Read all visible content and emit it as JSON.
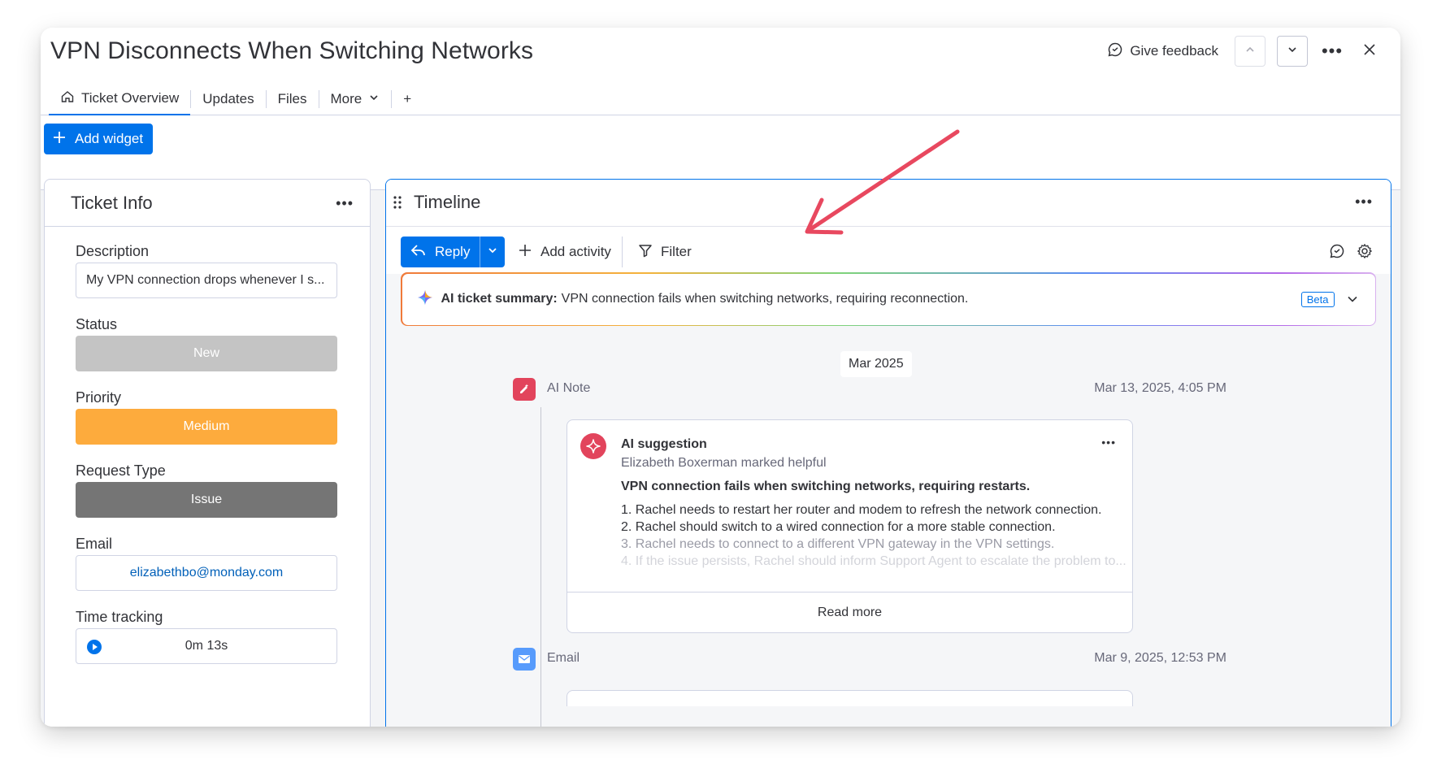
{
  "header": {
    "title": "VPN Disconnects When Switching Networks",
    "give_feedback": "Give feedback"
  },
  "tabs": [
    {
      "label": "Ticket Overview"
    },
    {
      "label": "Updates"
    },
    {
      "label": "Files"
    },
    {
      "label": "More"
    },
    {
      "label": "+"
    }
  ],
  "toolbar": {
    "add_widget": "Add widget"
  },
  "ticket_info": {
    "title": "Ticket Info",
    "description_label": "Description",
    "description_value": "My VPN connection drops whenever I s...",
    "status_label": "Status",
    "status_value": "New",
    "priority_label": "Priority",
    "priority_value": "Medium",
    "request_type_label": "Request Type",
    "request_type_value": "Issue",
    "email_label": "Email",
    "email_value": "elizabethbo@monday.com",
    "time_tracking_label": "Time tracking",
    "time_tracking_value": "0m 13s"
  },
  "timeline": {
    "title": "Timeline",
    "reply": "Reply",
    "add_activity": "Add activity",
    "filter": "Filter",
    "ai_summary_label": "AI ticket summary:",
    "ai_summary_text": "VPN connection fails when switching networks, requiring reconnection.",
    "beta": "Beta",
    "month": "Mar 2025",
    "events": [
      {
        "label": "AI Note",
        "date": "Mar 13, 2025, 4:05 PM"
      },
      {
        "label": "Email",
        "date": "Mar 9, 2025, 12:53 PM"
      }
    ],
    "card": {
      "title": "AI suggestion",
      "subtitle": "Elizabeth Boxerman marked helpful",
      "headline": "VPN connection fails when switching networks, requiring restarts.",
      "lines": [
        "1. Rachel needs to restart her router and modem to refresh the network connection.",
        "2. Rachel should switch to a wired connection for a more stable connection.",
        "3. Rachel needs to connect to a different VPN gateway in the VPN settings.",
        "4. If the issue persists, Rachel should inform Support Agent to escalate the problem to..."
      ],
      "read_more": "Read more"
    }
  },
  "colors": {
    "primary": "#0073ea",
    "status_new": "#c4c4c4",
    "priority_medium": "#fdab3d",
    "request_issue": "#757575",
    "ai_note_icon": "#e2445c",
    "email_icon": "#579bfc",
    "annotation_arrow": "#e8485f"
  },
  "icons": [
    "home-icon",
    "chevron-down-icon",
    "feedback-icon",
    "chevron-up-icon",
    "more-icon",
    "close-icon",
    "plus-icon",
    "drag-handle-icon",
    "reply-icon",
    "filter-icon",
    "chat-icon",
    "gear-icon",
    "sparkle-icon",
    "play-icon",
    "ai-note-icon",
    "email-icon"
  ]
}
